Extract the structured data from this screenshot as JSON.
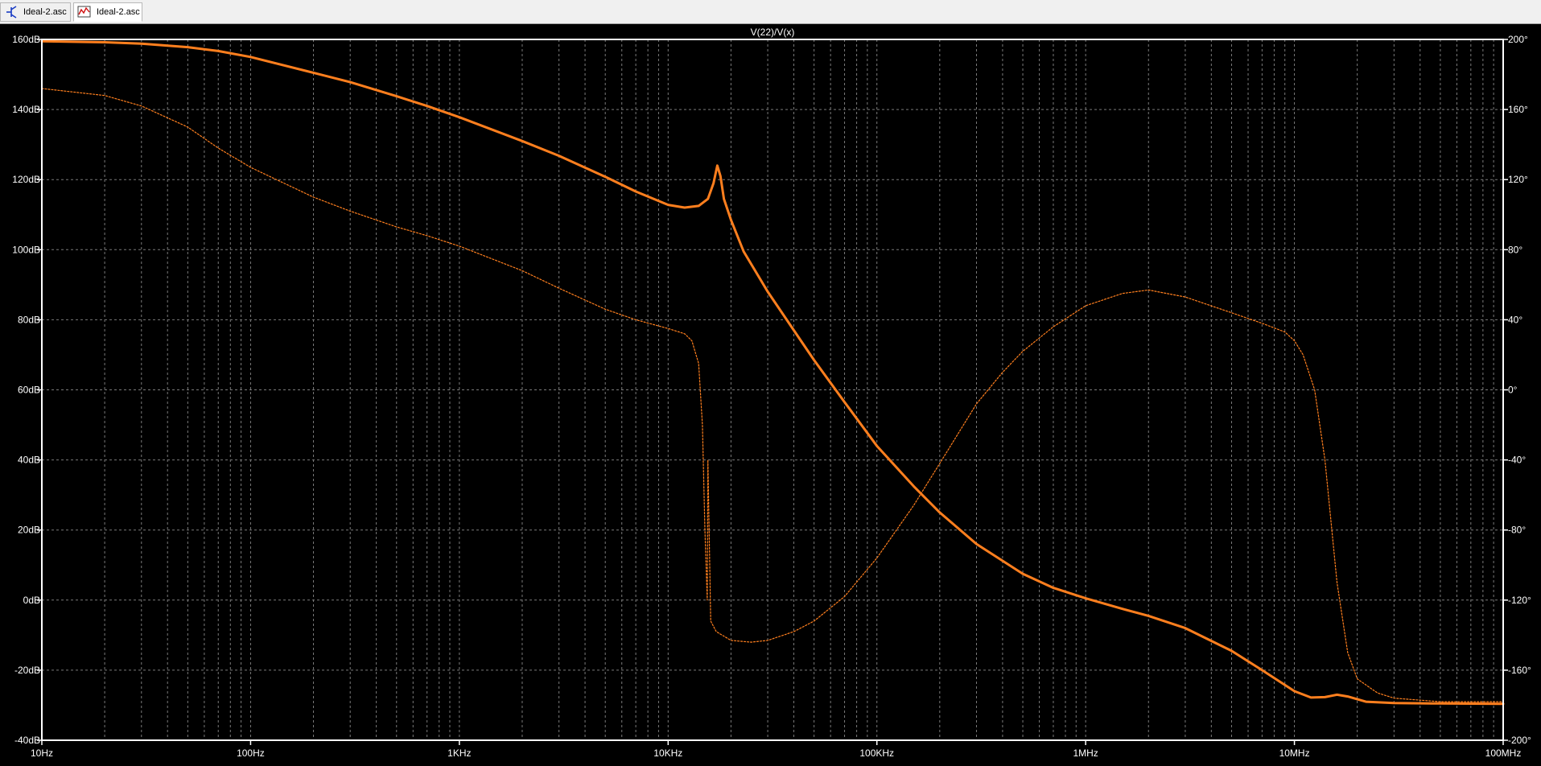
{
  "tabs": [
    {
      "label": "Ideal-2.asc",
      "icon": "schematic-icon",
      "active": false
    },
    {
      "label": "Ideal-2.asc",
      "icon": "waveform-icon",
      "active": true
    }
  ],
  "colors": {
    "background": "#000000",
    "axis": "#ffffff",
    "grid": "#7a7a7a",
    "trace": "#ff7f1e",
    "text": "#ffffff"
  },
  "chart_data": {
    "type": "line",
    "title": "V(22)/V(x)",
    "xscale": "log",
    "xlim": [
      10,
      100000000
    ],
    "x_ticks": [
      "10Hz",
      "100Hz",
      "1KHz",
      "10KHz",
      "100KHz",
      "1MHz",
      "10MHz",
      "100MHz"
    ],
    "ylim_left": [
      -40,
      160
    ],
    "y_ticks_left": [
      "160dB",
      "140dB",
      "120dB",
      "100dB",
      "80dB",
      "60dB",
      "40dB",
      "20dB",
      "0dB",
      "-20dB",
      "-40dB"
    ],
    "ylim_right": [
      -200,
      200
    ],
    "y_ticks_right": [
      "200°",
      "160°",
      "120°",
      "80°",
      "40°",
      "0°",
      "-40°",
      "-80°",
      "-120°",
      "-160°",
      "-200°"
    ],
    "grid": true,
    "series": [
      {
        "name": "magnitude",
        "style": "solid",
        "axis": "left",
        "points": [
          [
            10,
            159.5
          ],
          [
            20,
            159.2
          ],
          [
            30,
            158.8
          ],
          [
            50,
            157.8
          ],
          [
            70,
            156.7
          ],
          [
            100,
            155.0
          ],
          [
            200,
            150.5
          ],
          [
            300,
            147.8
          ],
          [
            500,
            143.8
          ],
          [
            700,
            141.0
          ],
          [
            1000,
            137.8
          ],
          [
            2000,
            131.0
          ],
          [
            3000,
            126.8
          ],
          [
            5000,
            120.8
          ],
          [
            7000,
            116.6
          ],
          [
            10000,
            112.8
          ],
          [
            12000,
            112.0
          ],
          [
            14000,
            112.5
          ],
          [
            15500,
            114.5
          ],
          [
            16500,
            119.0
          ],
          [
            17200,
            124.0
          ],
          [
            17800,
            121.0
          ],
          [
            18500,
            114.5
          ],
          [
            20000,
            108.5
          ],
          [
            23000,
            99.5
          ],
          [
            30000,
            88.0
          ],
          [
            40000,
            77.0
          ],
          [
            50000,
            68.5
          ],
          [
            70000,
            56.5
          ],
          [
            100000,
            44.0
          ],
          [
            150000,
            32.5
          ],
          [
            200000,
            25.0
          ],
          [
            300000,
            16.0
          ],
          [
            500000,
            7.5
          ],
          [
            700000,
            3.5
          ],
          [
            1000000,
            0.5
          ],
          [
            1500000,
            -2.5
          ],
          [
            2000000,
            -4.5
          ],
          [
            3000000,
            -8.0
          ],
          [
            5000000,
            -14.5
          ],
          [
            7000000,
            -20.0
          ],
          [
            10000000,
            -26.0
          ],
          [
            12000000,
            -27.8
          ],
          [
            14000000,
            -27.7
          ],
          [
            16000000,
            -27.0
          ],
          [
            18000000,
            -27.5
          ],
          [
            22000000,
            -29.0
          ],
          [
            30000000,
            -29.4
          ],
          [
            50000000,
            -29.5
          ],
          [
            100000000,
            -29.6
          ]
        ]
      },
      {
        "name": "phase",
        "style": "dashed",
        "axis": "right",
        "points": [
          [
            10,
            172
          ],
          [
            20,
            168
          ],
          [
            30,
            162
          ],
          [
            50,
            150
          ],
          [
            70,
            138
          ],
          [
            100,
            127
          ],
          [
            200,
            110
          ],
          [
            300,
            102
          ],
          [
            500,
            93
          ],
          [
            700,
            88
          ],
          [
            1000,
            82
          ],
          [
            2000,
            68
          ],
          [
            3000,
            58
          ],
          [
            5000,
            46
          ],
          [
            7000,
            40
          ],
          [
            10000,
            35
          ],
          [
            12000,
            32
          ],
          [
            13000,
            28
          ],
          [
            14000,
            15
          ],
          [
            14600,
            -20
          ],
          [
            15000,
            -80
          ],
          [
            15400,
            -120
          ],
          [
            16000,
            -132
          ],
          [
            17000,
            -138
          ],
          [
            20000,
            -143
          ],
          [
            25000,
            -144
          ],
          [
            30000,
            -143
          ],
          [
            40000,
            -138
          ],
          [
            50000,
            -132
          ],
          [
            70000,
            -118
          ],
          [
            100000,
            -96
          ],
          [
            150000,
            -66
          ],
          [
            200000,
            -42
          ],
          [
            300000,
            -8
          ],
          [
            400000,
            10
          ],
          [
            500000,
            22
          ],
          [
            700000,
            36
          ],
          [
            1000000,
            48
          ],
          [
            1500000,
            55
          ],
          [
            2000000,
            57
          ],
          [
            3000000,
            53
          ],
          [
            5000000,
            44
          ],
          [
            7000000,
            38
          ],
          [
            9000000,
            33
          ],
          [
            10000000,
            28
          ],
          [
            11000000,
            20
          ],
          [
            12500000,
            0
          ],
          [
            14000000,
            -40
          ],
          [
            15500,
            -40
          ],
          [
            16000000,
            -110
          ],
          [
            18000000,
            -150
          ],
          [
            20000000,
            -165
          ],
          [
            25000000,
            -173
          ],
          [
            30000000,
            -176
          ],
          [
            50000000,
            -178
          ],
          [
            100000000,
            -178
          ]
        ]
      }
    ]
  }
}
